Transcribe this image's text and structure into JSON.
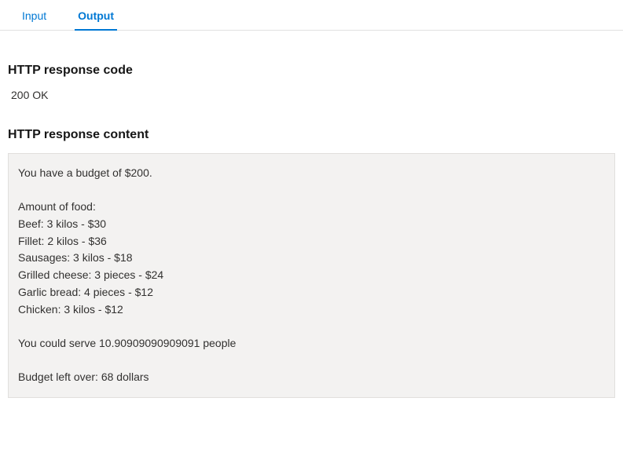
{
  "tabs": {
    "input": "Input",
    "output": "Output"
  },
  "sections": {
    "code_heading": "HTTP response code",
    "code_value": "200 OK",
    "content_heading": "HTTP response content",
    "content_body": "You have a budget of $200.\n\nAmount of food:\nBeef: 3 kilos - $30\nFillet: 2 kilos - $36\nSausages: 3 kilos - $18\nGrilled cheese: 3 pieces - $24\nGarlic bread: 4 pieces - $12\nChicken: 3 kilos - $12\n\nYou could serve 10.90909090909091 people\n\nBudget left over: 68 dollars"
  }
}
